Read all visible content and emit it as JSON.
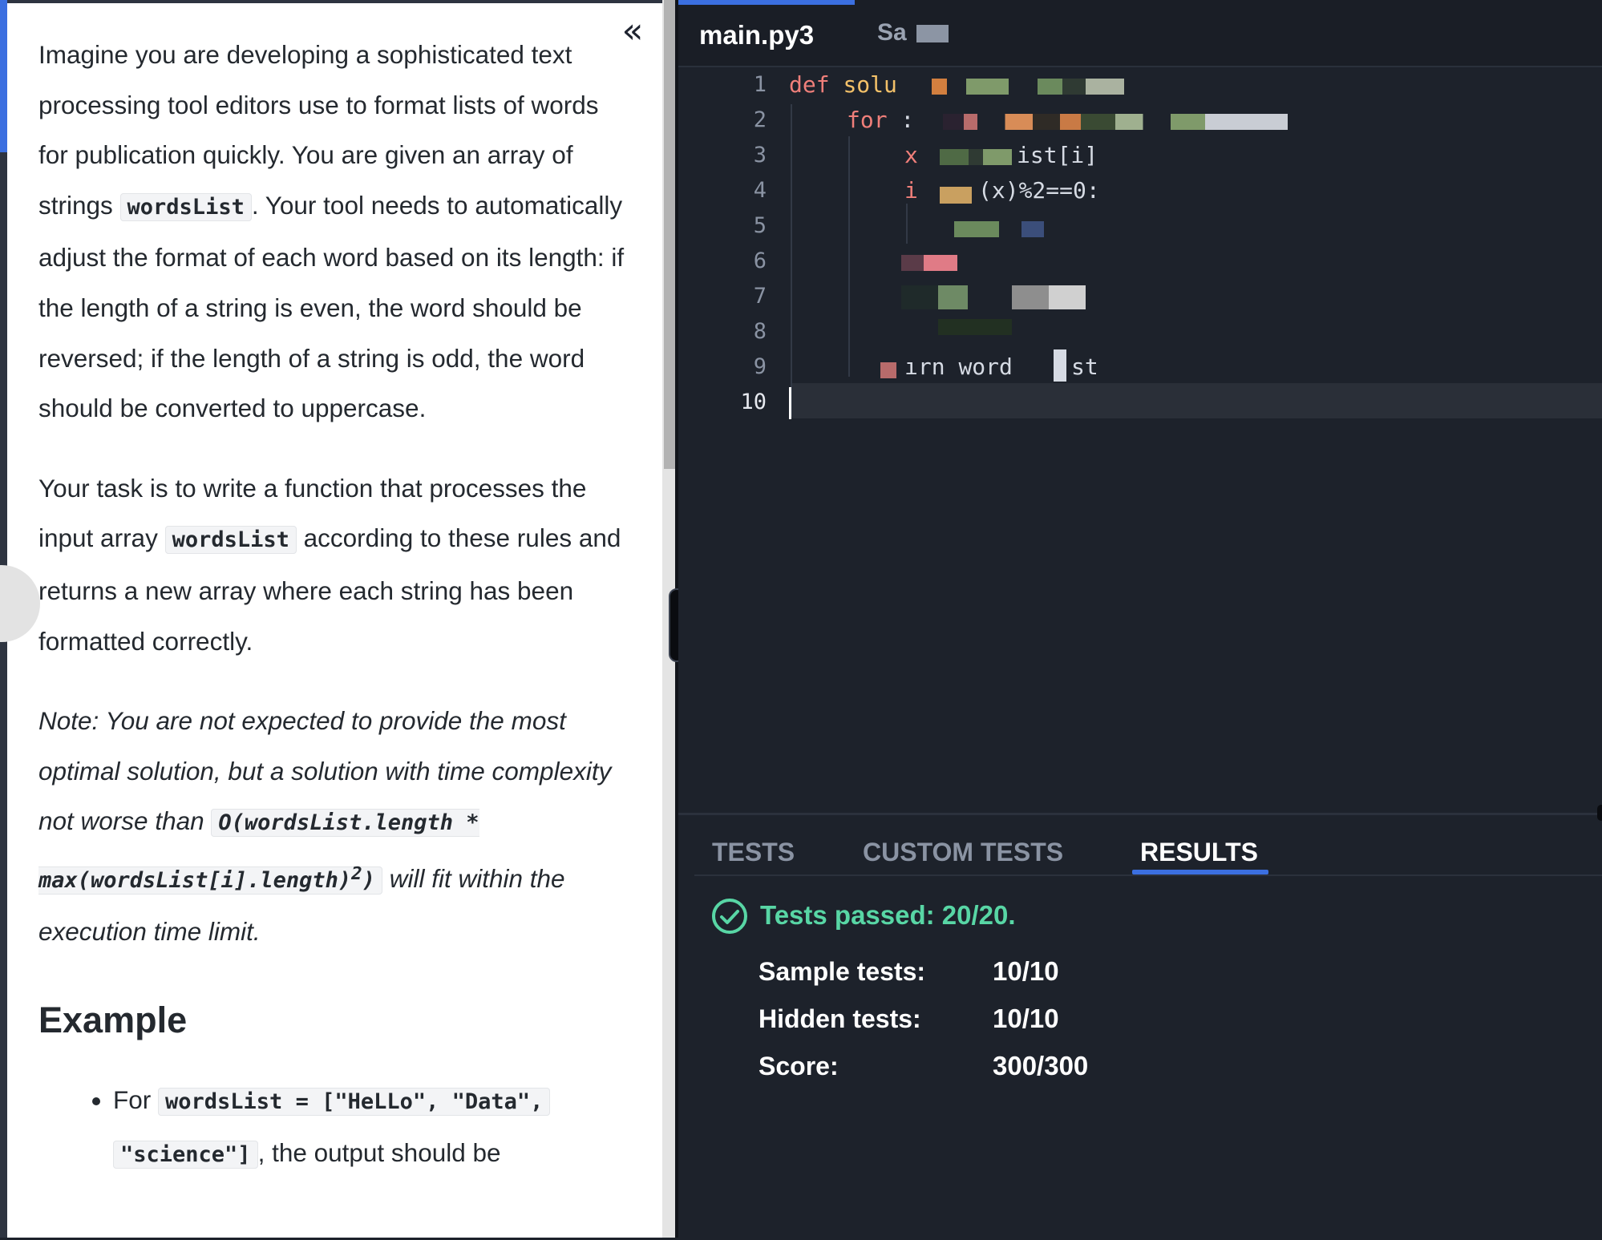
{
  "problem": {
    "collapse_icon": "«",
    "p1_a": "Imagine you are developing a sophisticated text processing tool editors use to format lists of words for publication quickly. You are given an array of strings ",
    "p1_code": "wordsList",
    "p1_b": ". Your tool needs to automatically adjust the format of each word based on its length: if the length of a string is even, the word should be reversed; if the length of a string is odd, the word should be converted to uppercase.",
    "p2_a": "Your task is to write a function that processes the input array ",
    "p2_code": "wordsList",
    "p2_b": " according to these rules and returns a new array where each string has been formatted correctly.",
    "note_a": "Note: You are not expected to provide the most optimal solution, but a solution with time complexity not worse than ",
    "note_code": "O(wordsList.length * max(wordsList[i].length)",
    "note_sup": "2",
    "note_code_end": ")",
    "note_b": " will fit within the execution time limit.",
    "example_heading": "Example",
    "example_item_a": "For ",
    "example_item_code1": "wordsList = [\"HeLLo\", \"Data\",",
    "example_item_code2": "\"science\"]",
    "example_item_b": ", the output should be"
  },
  "editor": {
    "tab_main": "main.py3",
    "tab_second": "Sa",
    "line_numbers": [
      "1",
      "2",
      "3",
      "4",
      "5",
      "6",
      "7",
      "8",
      "9",
      "10"
    ],
    "code": {
      "line1_kw": "def",
      "line1_fn": "solu",
      "line2_kw": "for",
      "line2_rest": " :",
      "line3_a": "x",
      "line3_b": "ist[i]",
      "line4_a": "i",
      "line4_b": "(x)%2==0:",
      "line9_a": "ırn",
      "line9_b": "word",
      "line9_c": "st"
    }
  },
  "results": {
    "tabs": [
      "TESTS",
      "CUSTOM TESTS",
      "RESULTS"
    ],
    "active_tab": "RESULTS",
    "pass_text": "Tests passed: 20/20.",
    "stats": [
      {
        "label": "Sample tests:",
        "value": "10/10"
      },
      {
        "label": "Hidden tests:",
        "value": "10/10"
      },
      {
        "label": "Score:",
        "value": "300/300"
      }
    ],
    "pass_color": "#58d6a5",
    "accent_color": "#3b6fe0"
  }
}
